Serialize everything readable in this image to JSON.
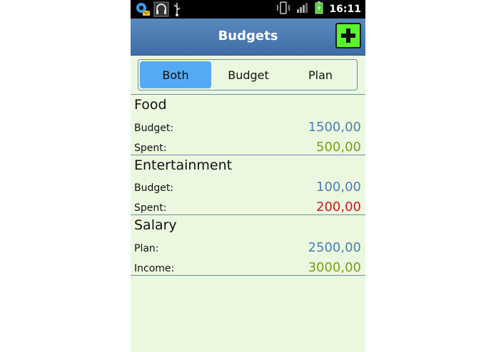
{
  "status_bar": {
    "time": "16:11",
    "left_icons": [
      "settings-mail-icon",
      "headset-icon",
      "usb-icon"
    ],
    "right_icons": [
      "vibrate-icon",
      "signal-icon",
      "battery-icon"
    ]
  },
  "header": {
    "title": "Budgets",
    "add_icon": "plus-icon"
  },
  "filter_tabs": [
    {
      "label": "Both",
      "active": true
    },
    {
      "label": "Budget",
      "active": false
    },
    {
      "label": "Plan",
      "active": false
    }
  ],
  "colors": {
    "header": "#4a7bb3",
    "background": "#ebf8df",
    "active_tab": "#55aaf5",
    "add_button": "#5cf232",
    "blue_value": "#4a7fb5",
    "green_value": "#7d9a17",
    "red_value": "#c31a1a"
  },
  "categories": [
    {
      "name": "Food",
      "rows": [
        {
          "label": "Budget:",
          "value": "1500,00",
          "color": "#4a7fb5"
        },
        {
          "label": "Spent:",
          "value": "500,00",
          "color": "#7d9a17"
        }
      ]
    },
    {
      "name": "Entertainment",
      "rows": [
        {
          "label": "Budget:",
          "value": "100,00",
          "color": "#4a7fb5"
        },
        {
          "label": "Spent:",
          "value": "200,00",
          "color": "#c31a1a"
        }
      ]
    },
    {
      "name": "Salary",
      "rows": [
        {
          "label": "Plan:",
          "value": "2500,00",
          "color": "#4a7fb5"
        },
        {
          "label": "Income:",
          "value": "3000,00",
          "color": "#7d9a17"
        }
      ]
    }
  ]
}
